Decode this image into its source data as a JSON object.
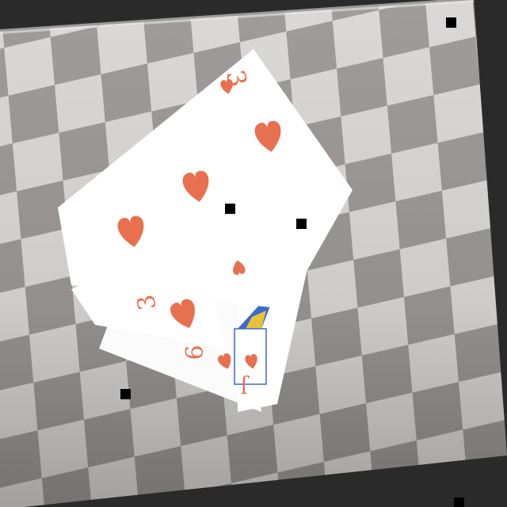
{
  "scene": {
    "description_hidden": "",
    "colors": {
      "frame": "#2a2a2a",
      "tile_light": "#d9d6d5",
      "tile_dark": "#8f8b8a",
      "card_face": "#ffffff",
      "suit": "#e8704f",
      "jack_blue": "#3a6ad0",
      "jack_yellow": "#e8c33a",
      "marker": "#000000"
    }
  },
  "cards": [
    {
      "rank": "3",
      "suit": "hearts",
      "suit_icon": "heart-icon"
    },
    {
      "rank": "3",
      "suit": "hearts",
      "suit_icon": "heart-icon"
    },
    {
      "rank": "6",
      "suit": "hearts",
      "suit_icon": "heart-icon"
    },
    {
      "rank": "J",
      "suit": "hearts",
      "suit_icon": "heart-icon"
    }
  ],
  "markers": {
    "count": 5,
    "shape": "square"
  }
}
